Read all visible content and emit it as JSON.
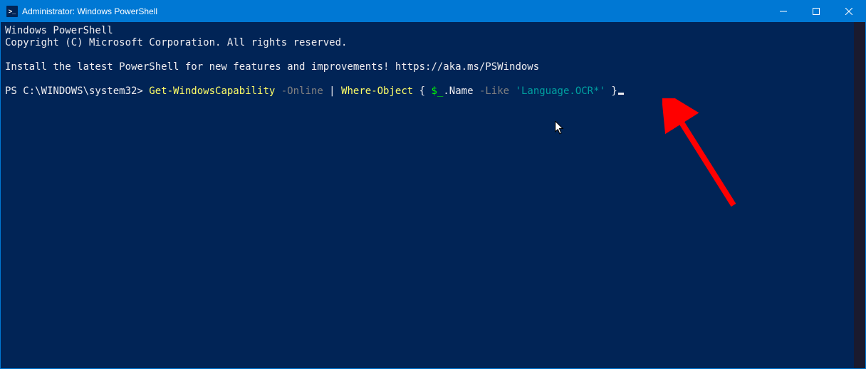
{
  "titlebar": {
    "icon_label": ">_",
    "title": "Administrator: Windows PowerShell",
    "minimize": "−",
    "maximize": "☐",
    "close": "✕"
  },
  "terminal": {
    "banner_line1": "Windows PowerShell",
    "banner_line2": "Copyright (C) Microsoft Corporation. All rights reserved.",
    "install_msg": "Install the latest PowerShell for new features and improvements! https://aka.ms/PSWindows",
    "prompt_prefix": "PS C:\\WINDOWS\\system32> ",
    "cmd": {
      "cmdlet1": "Get-WindowsCapability",
      "param1": " -Online",
      "pipe": " | ",
      "cmdlet2": "Where-Object",
      "brace_open": " { ",
      "var": "$_",
      "prop": ".Name",
      "op": " -Like",
      "space": " ",
      "str": "'Language.OCR*'",
      "brace_close": " }"
    }
  },
  "colors": {
    "titlebar_bg": "#0078d4",
    "terminal_bg": "#012456",
    "text_default": "#eeedf0",
    "text_cmd": "#ffff66",
    "text_param": "#808080",
    "text_var": "#00ff00",
    "text_str": "#00a0a0",
    "arrow": "#ff0000"
  }
}
